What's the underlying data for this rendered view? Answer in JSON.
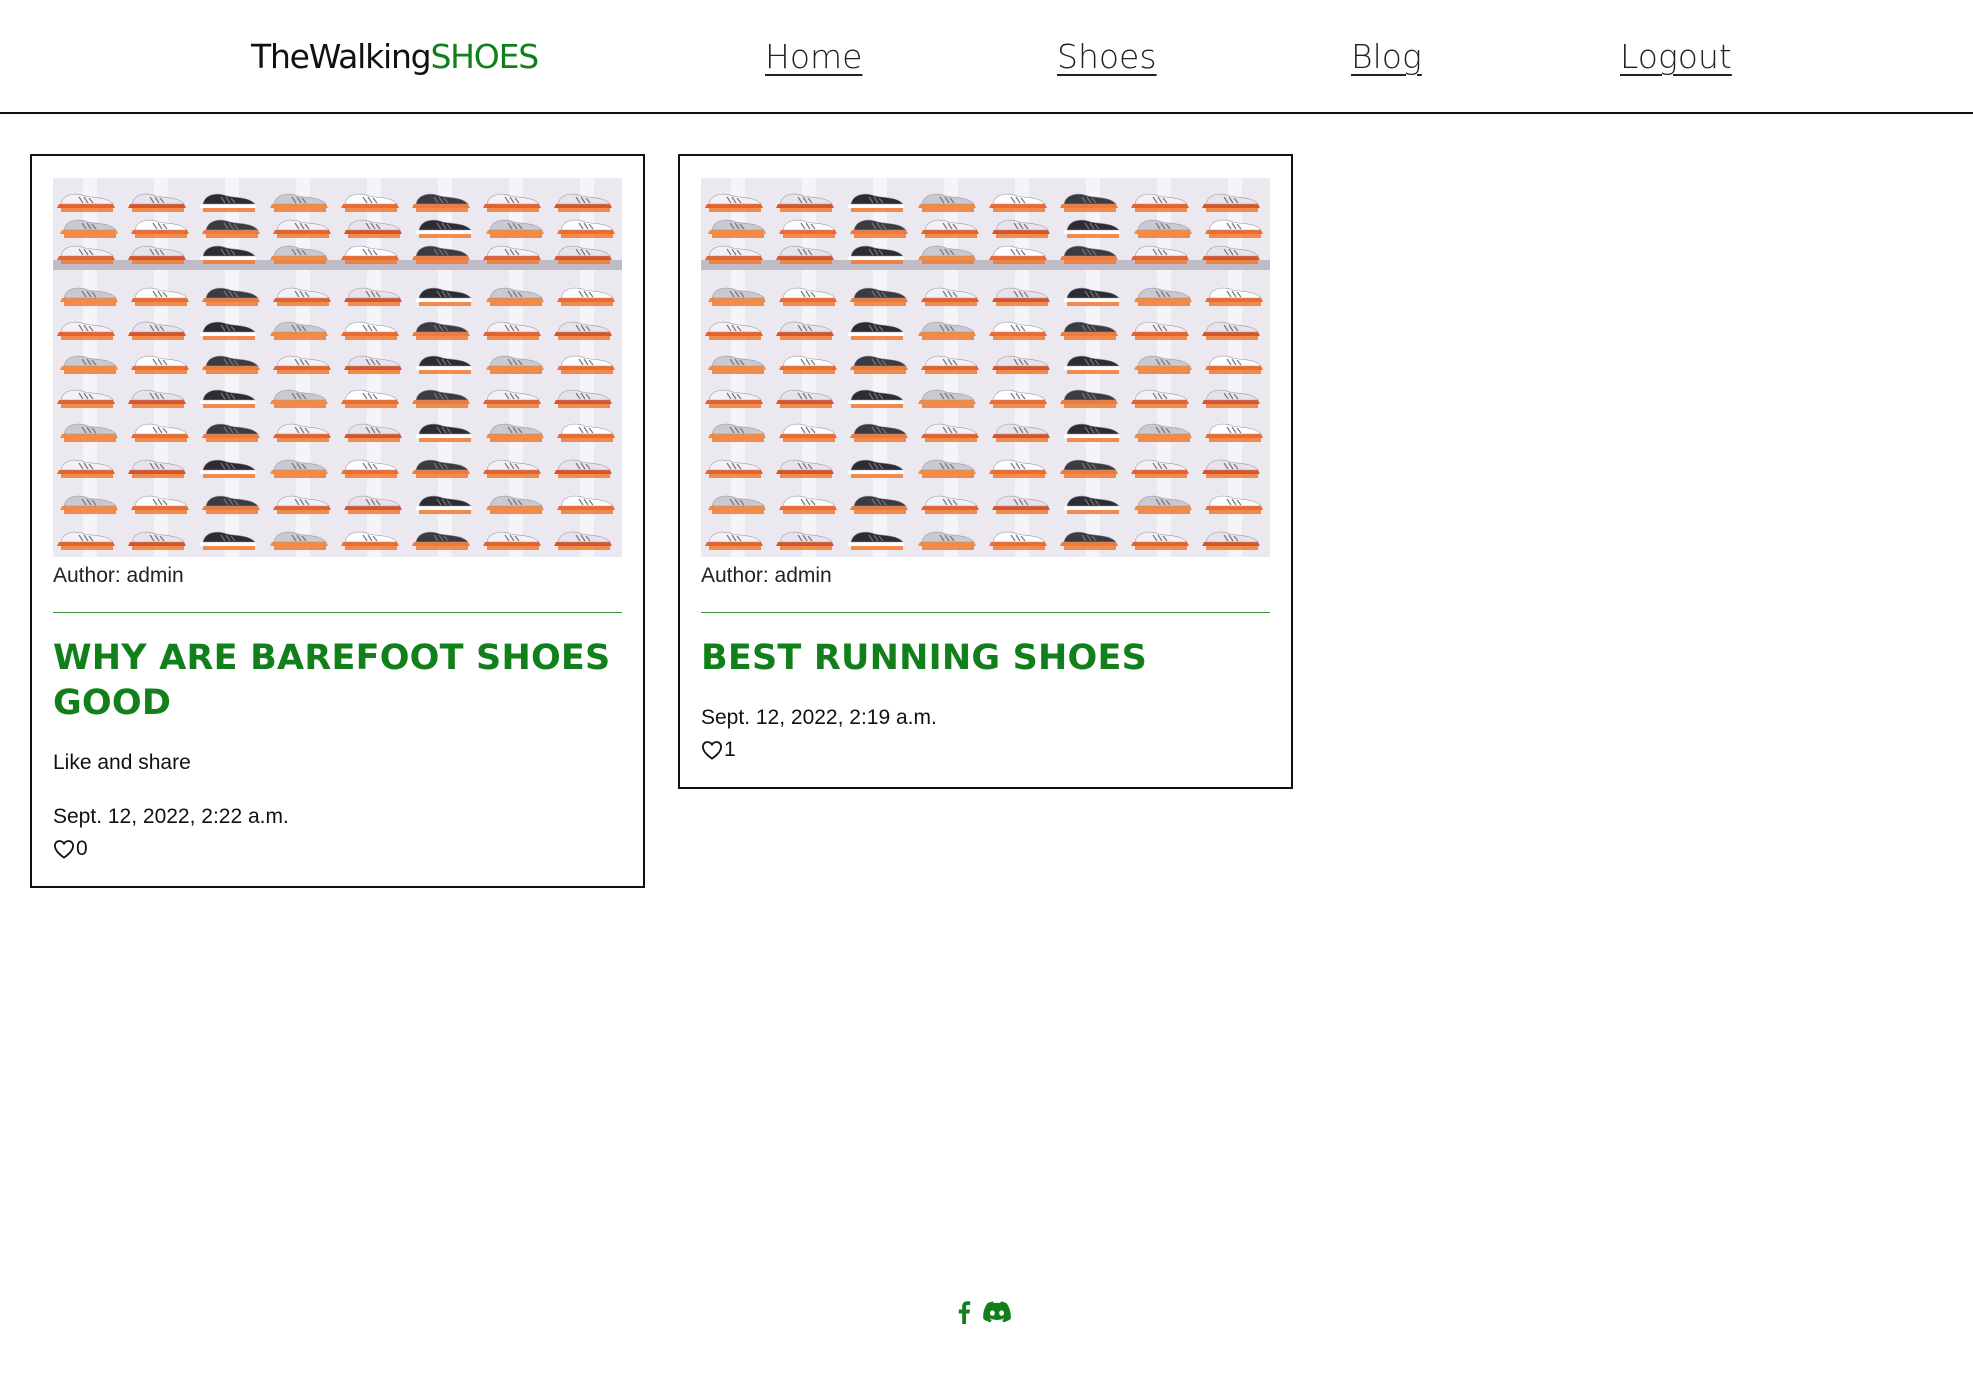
{
  "header": {
    "brand_part1": "TheWalking",
    "brand_part2": "SHOES",
    "nav": [
      {
        "label": "Home"
      },
      {
        "label": "Shoes"
      },
      {
        "label": "Blog"
      },
      {
        "label": "Logout"
      }
    ]
  },
  "posts": [
    {
      "author": "Author: admin",
      "title": "WHY ARE BAREFOOT SHOES GOOD",
      "excerpt": "Like and share",
      "date": "Sept. 12, 2022, 2:22 a.m.",
      "likes": "0",
      "image_icon": "shoe-wall-photo"
    },
    {
      "author": "Author: admin",
      "title": "BEST RUNNING SHOES",
      "excerpt": "",
      "date": "Sept. 12, 2022, 2:19 a.m.",
      "likes": "1",
      "image_icon": "shoe-wall-photo"
    }
  ],
  "footer": {
    "icons": [
      "facebook-icon",
      "discord-icon"
    ],
    "accent_color": "#12801a"
  },
  "colors": {
    "brand_green": "#12801a",
    "text": "#111111",
    "border": "#111111"
  }
}
